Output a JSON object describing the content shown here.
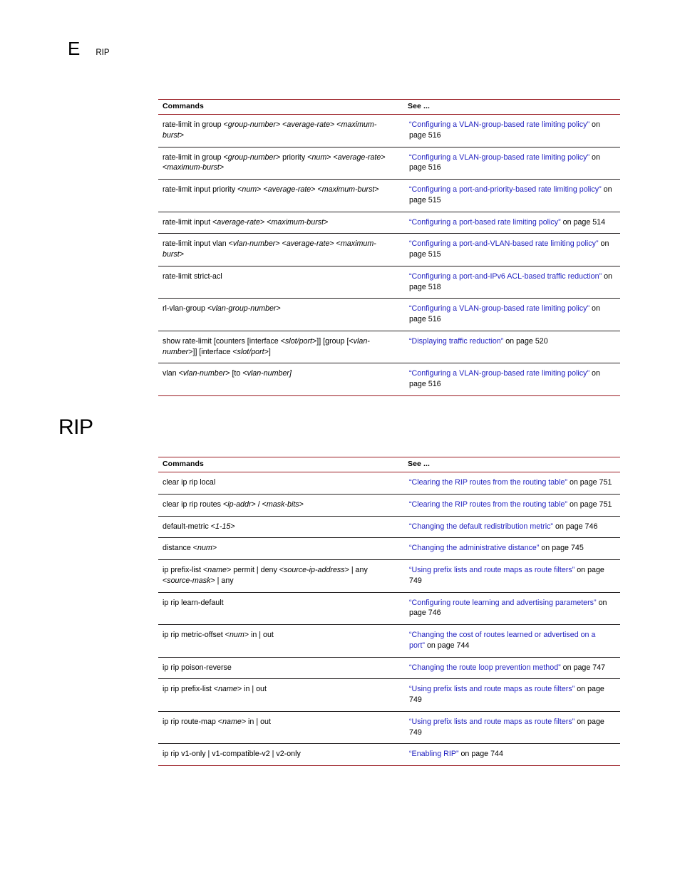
{
  "header": {
    "letter": "E",
    "label": "RIP"
  },
  "sections": [
    {
      "title": "",
      "table": {
        "columns": [
          "Commands",
          "See ..."
        ],
        "rows": [
          {
            "command": "rate-limit in group <group-number> <average-rate> <maximum-burst>",
            "see_link": "“Configuring a VLAN-group-based rate limiting policy”",
            "see_tail": " on page 516"
          },
          {
            "command": "rate-limit in group <group-number> priority <num> <average-rate> <maximum-burst>",
            "see_link": "“Configuring a VLAN-group-based rate limiting policy”",
            "see_tail": " on page 516"
          },
          {
            "command": "rate-limit input priority <num> <average-rate> <maximum-burst>",
            "see_link": "“Configuring a port-and-priority-based rate limiting policy”",
            "see_tail": " on page 515"
          },
          {
            "command": "rate-limit input <average-rate> <maximum-burst>",
            "see_link": "“Configuring a port-based rate limiting policy”",
            "see_tail": " on page 514"
          },
          {
            "command": "rate-limit input vlan <vlan-number> <average-rate> <maximum-burst>",
            "see_link": "“Configuring a port-and-VLAN-based rate limiting policy”",
            "see_tail": " on page 515"
          },
          {
            "command": "rate-limit strict-acl",
            "see_link": "“Configuring a port-and-IPv6 ACL-based traffic reduction”",
            "see_tail": " on page 518"
          },
          {
            "command": "rl-vlan-group <vlan-group-number>",
            "see_link": "“Configuring a VLAN-group-based rate limiting policy”",
            "see_tail": " on page 516"
          },
          {
            "command": "show rate-limit [counters [interface <slot/port>]] [group [<vlan-number>]]   [interface <slot/port>]",
            "see_link": "“Displaying traffic reduction”",
            "see_tail": " on page 520"
          },
          {
            "command": "vlan <vlan-number> [to <vlan-number]",
            "see_link": "“Configuring a VLAN-group-based rate limiting policy”",
            "see_tail": " on page 516"
          }
        ]
      }
    },
    {
      "title": "RIP",
      "table": {
        "columns": [
          "Commands",
          "See ..."
        ],
        "rows": [
          {
            "command": "clear ip rip local",
            "see_link": "“Clearing the RIP routes from the routing table”",
            "see_tail": " on page 751"
          },
          {
            "command": "clear ip rip routes <ip-addr> / <mask-bits>",
            "see_link": "“Clearing the RIP routes from the routing table”",
            "see_tail": " on page 751"
          },
          {
            "command": "default-metric <1-15>",
            "see_link": "“Changing the default redistribution metric”",
            "see_tail": " on page 746"
          },
          {
            "command": "distance <num>",
            "see_link": "“Changing the administrative distance”",
            "see_tail": " on page 745"
          },
          {
            "command": "ip prefix-list <name> permit | deny <source-ip-address> | any <source-mask> | any",
            "see_link": "“Using prefix lists and route maps as route filters”",
            "see_tail": " on page 749"
          },
          {
            "command": "ip rip learn-default",
            "see_link": "“Configuring route learning and advertising parameters”",
            "see_tail": " on page 746"
          },
          {
            "command": "ip rip metric-offset <num> in | out",
            "see_link": "“Changing the cost of routes learned or advertised on a port”",
            "see_tail": " on page 744"
          },
          {
            "command": "ip rip poison-reverse",
            "see_link": "“Changing the route loop prevention method”",
            "see_tail": " on page 747"
          },
          {
            "command": "ip rip prefix-list <name> in | out",
            "see_link": "“Using prefix lists and route maps as route filters”",
            "see_tail": " on page 749"
          },
          {
            "command": "ip rip route-map <name> in | out",
            "see_link": "“Using prefix lists and route maps as route filters”",
            "see_tail": " on page 749"
          },
          {
            "command": "ip rip v1-only | v1-compatible-v2 | v2-only",
            "see_link": "“Enabling RIP”",
            "see_tail": " on page 744"
          }
        ]
      }
    }
  ],
  "colors": {
    "rule": "#9a1b22",
    "link": "#1f1fbf",
    "text": "#000000"
  }
}
